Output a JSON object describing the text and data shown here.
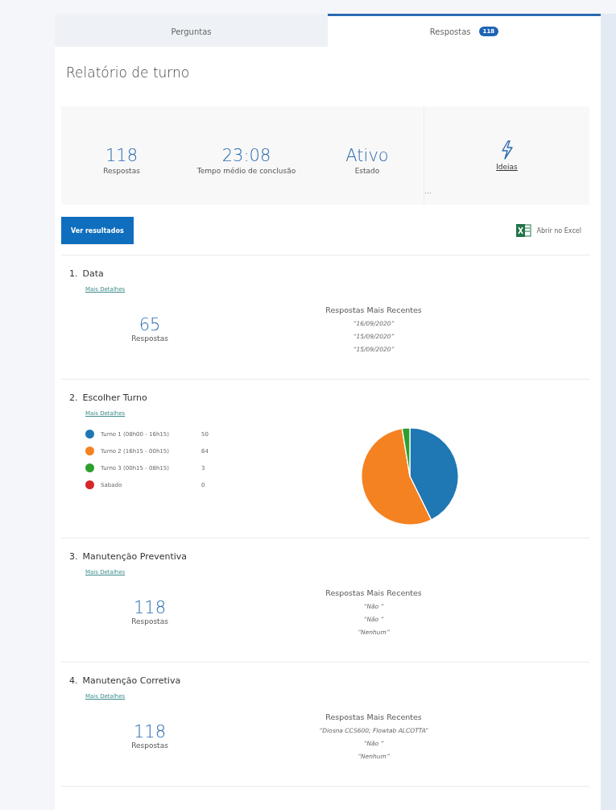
{
  "tabs": [
    {
      "label": "Perguntas",
      "selected": false
    },
    {
      "label": "Respostas",
      "selected": true,
      "badge": "118"
    }
  ],
  "title": "Relatório de turno",
  "stats": [
    {
      "value": "118",
      "label": "Respostas"
    },
    {
      "value": "23:08",
      "label": "Tempo médio de conclusão"
    },
    {
      "value": "Ativo",
      "label": "Estado"
    }
  ],
  "ideas_link": "Ideias",
  "more": "...",
  "view_results_button": "Ver resultados",
  "excel_link": "Abrir no Excel",
  "questions": [
    {
      "kind": "text",
      "number": "1.",
      "title": "Data",
      "details_link": "Mais Detalhes",
      "count": "65",
      "count_label": "Respostas",
      "recent_heading": "Respostas Mais Recentes",
      "recent": [
        "“16/09/2020”",
        "“15/09/2020”",
        "“15/09/2020”"
      ]
    },
    {
      "kind": "choice",
      "number": "2.",
      "title": "Escolher Turno",
      "details_link": "Mais Detalhes",
      "options": [
        {
          "count": "50",
          "color": "#1f77b4"
        },
        {
          "count": "64",
          "color": "#f58220"
        },
        {
          "count": "3",
          "color": "#2ca02c"
        },
        {
          "count": "0",
          "color": "#d62728"
        }
      ],
      "chart_data": {
        "type": "pie",
        "categories": [
          "Turno 1 (08h00 - 16h15)",
          "Turno 2 (16h15 - 00h15)",
          "Turno 3 (00h15 - 08h15)",
          "Sabado"
        ],
        "values": [
          50,
          64,
          3,
          0
        ]
      }
    },
    {
      "kind": "text",
      "number": "3.",
      "title": "Manutenção Preventiva",
      "details_link": "Mais Detalhes",
      "count": "118",
      "count_label": "Respostas",
      "recent_heading": "Respostas Mais Recentes",
      "recent": [
        "“Não ”",
        "“Não ”",
        "“Nenhum”"
      ]
    },
    {
      "kind": "text",
      "number": "4.",
      "title": "Manutenção Corretiva",
      "details_link": "Mais Detalhes",
      "count": "118",
      "count_label": "Respostas",
      "recent_heading": "Respostas Mais Recentes",
      "recent": [
        "“Diosna CCS600; Flowtab ALCOTTA”",
        "“Não ”",
        "“Nenhum”"
      ]
    }
  ]
}
